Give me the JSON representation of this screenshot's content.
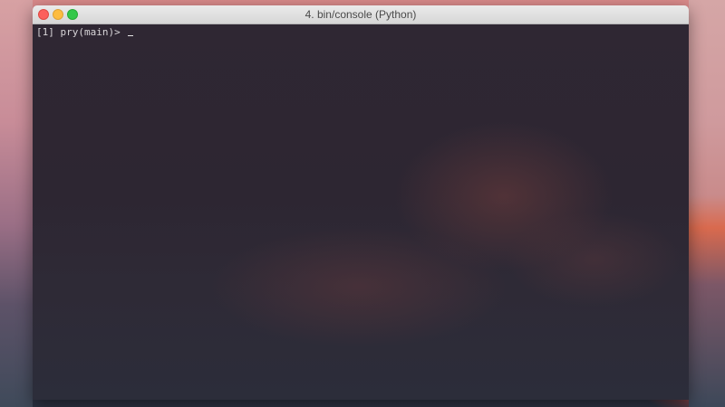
{
  "window": {
    "title": "4. bin/console (Python)"
  },
  "terminal": {
    "prompt": "[1] pry(main)>",
    "input": ""
  },
  "colors": {
    "close": "#fc605c",
    "minimize": "#fdbc40",
    "zoom": "#34c84a",
    "terminal_background": "#2d2632"
  }
}
